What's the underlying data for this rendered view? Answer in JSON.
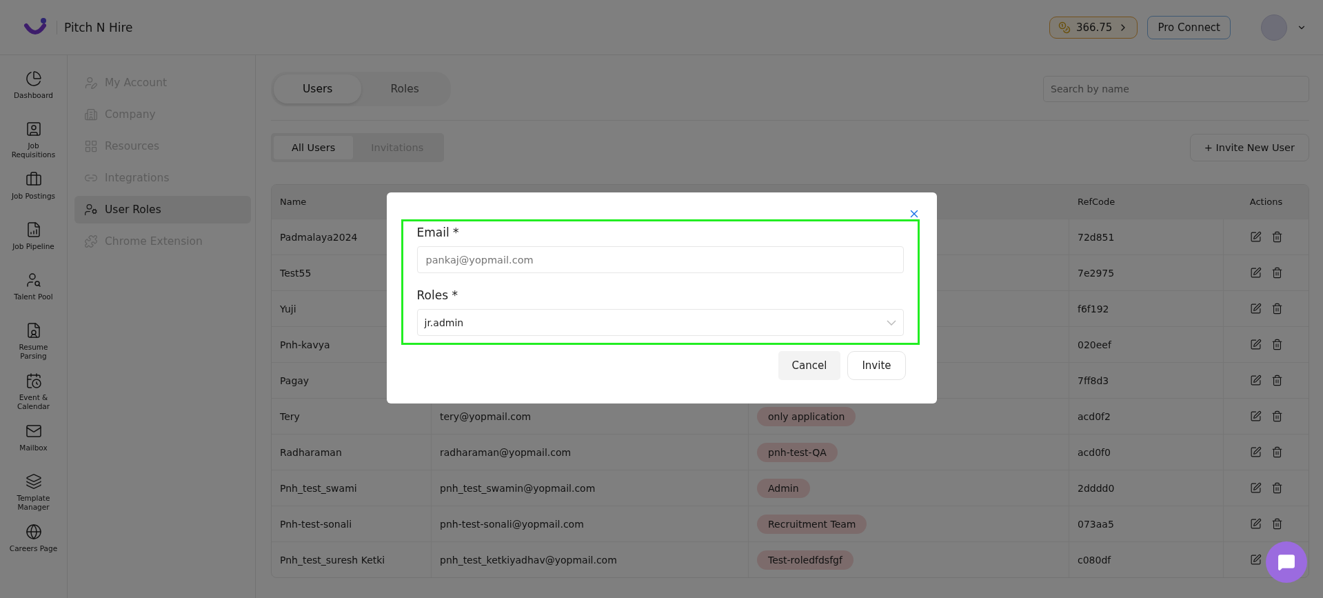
{
  "header": {
    "app_name": "Pitch N Hire",
    "credits": "366.75",
    "pro_button": "Pro Connect"
  },
  "nav": [
    {
      "label": "Dashboard"
    },
    {
      "label": "Job Requisitions"
    },
    {
      "label": "Job Postings"
    },
    {
      "label": "Job Pipeline"
    },
    {
      "label": "Talent Pool"
    },
    {
      "label": "Resume Parsing"
    },
    {
      "label": "Event & Calendar"
    },
    {
      "label": "Mailbox"
    },
    {
      "label": "Template Manager"
    },
    {
      "label": "Careers Page"
    }
  ],
  "settings_menu": [
    {
      "label": "My Account",
      "selected": false
    },
    {
      "label": "Company",
      "selected": false
    },
    {
      "label": "Resources",
      "selected": false
    },
    {
      "label": "Integrations",
      "selected": false
    },
    {
      "label": "User Roles",
      "selected": true
    },
    {
      "label": "Chrome Extension",
      "selected": false
    }
  ],
  "main_tabs": [
    {
      "label": "Users",
      "selected": true
    },
    {
      "label": "Roles",
      "selected": false
    }
  ],
  "search": {
    "placeholder": "Search by name"
  },
  "sub_tabs": [
    {
      "label": "All Users",
      "selected": true
    },
    {
      "label": "Invitations",
      "selected": false
    }
  ],
  "invite_button": "+ Invite New User",
  "table": {
    "columns": [
      "Name",
      "RefCode",
      "Actions"
    ],
    "rows": [
      {
        "name": "Padmalaya2024",
        "refcode": "72d851"
      },
      {
        "name": "Test55",
        "refcode": "7e2975"
      },
      {
        "name": "Yuji",
        "refcode": "f6f192"
      },
      {
        "name": "Pnh-kavya",
        "refcode": "020eef"
      },
      {
        "name": "Pagay",
        "refcode": "7ff8d3"
      },
      {
        "name": "Tery",
        "email": "tery@yopmail.com",
        "role": "only application",
        "refcode": "acd0f2"
      },
      {
        "name": "Radharaman",
        "email": "radharaman@yopmail.com",
        "role": "pnh-test-QA",
        "refcode": "acd0f0"
      },
      {
        "name": "Pnh_test_swami",
        "email": "pnh_test_swamin@yopmail.com",
        "role": "Admin",
        "refcode": "2dddd0"
      },
      {
        "name": "Pnh-test-sonali",
        "email": "pnh-test-sonali@yopmail.com",
        "role": "Recruitment Team",
        "refcode": "073aa5"
      },
      {
        "name": "Pnh_test_suresh Ketki",
        "email": "pnh_test_ketkiyadhav@yopmail.com",
        "role": "Test-roledfdsfgf",
        "refcode": "c080df"
      }
    ]
  },
  "modal": {
    "email_label": "Email *",
    "email_placeholder": "pankaj@yopmail.com",
    "roles_label": "Roles *",
    "roles_value": "jr.admin",
    "cancel": "Cancel",
    "invite": "Invite"
  }
}
